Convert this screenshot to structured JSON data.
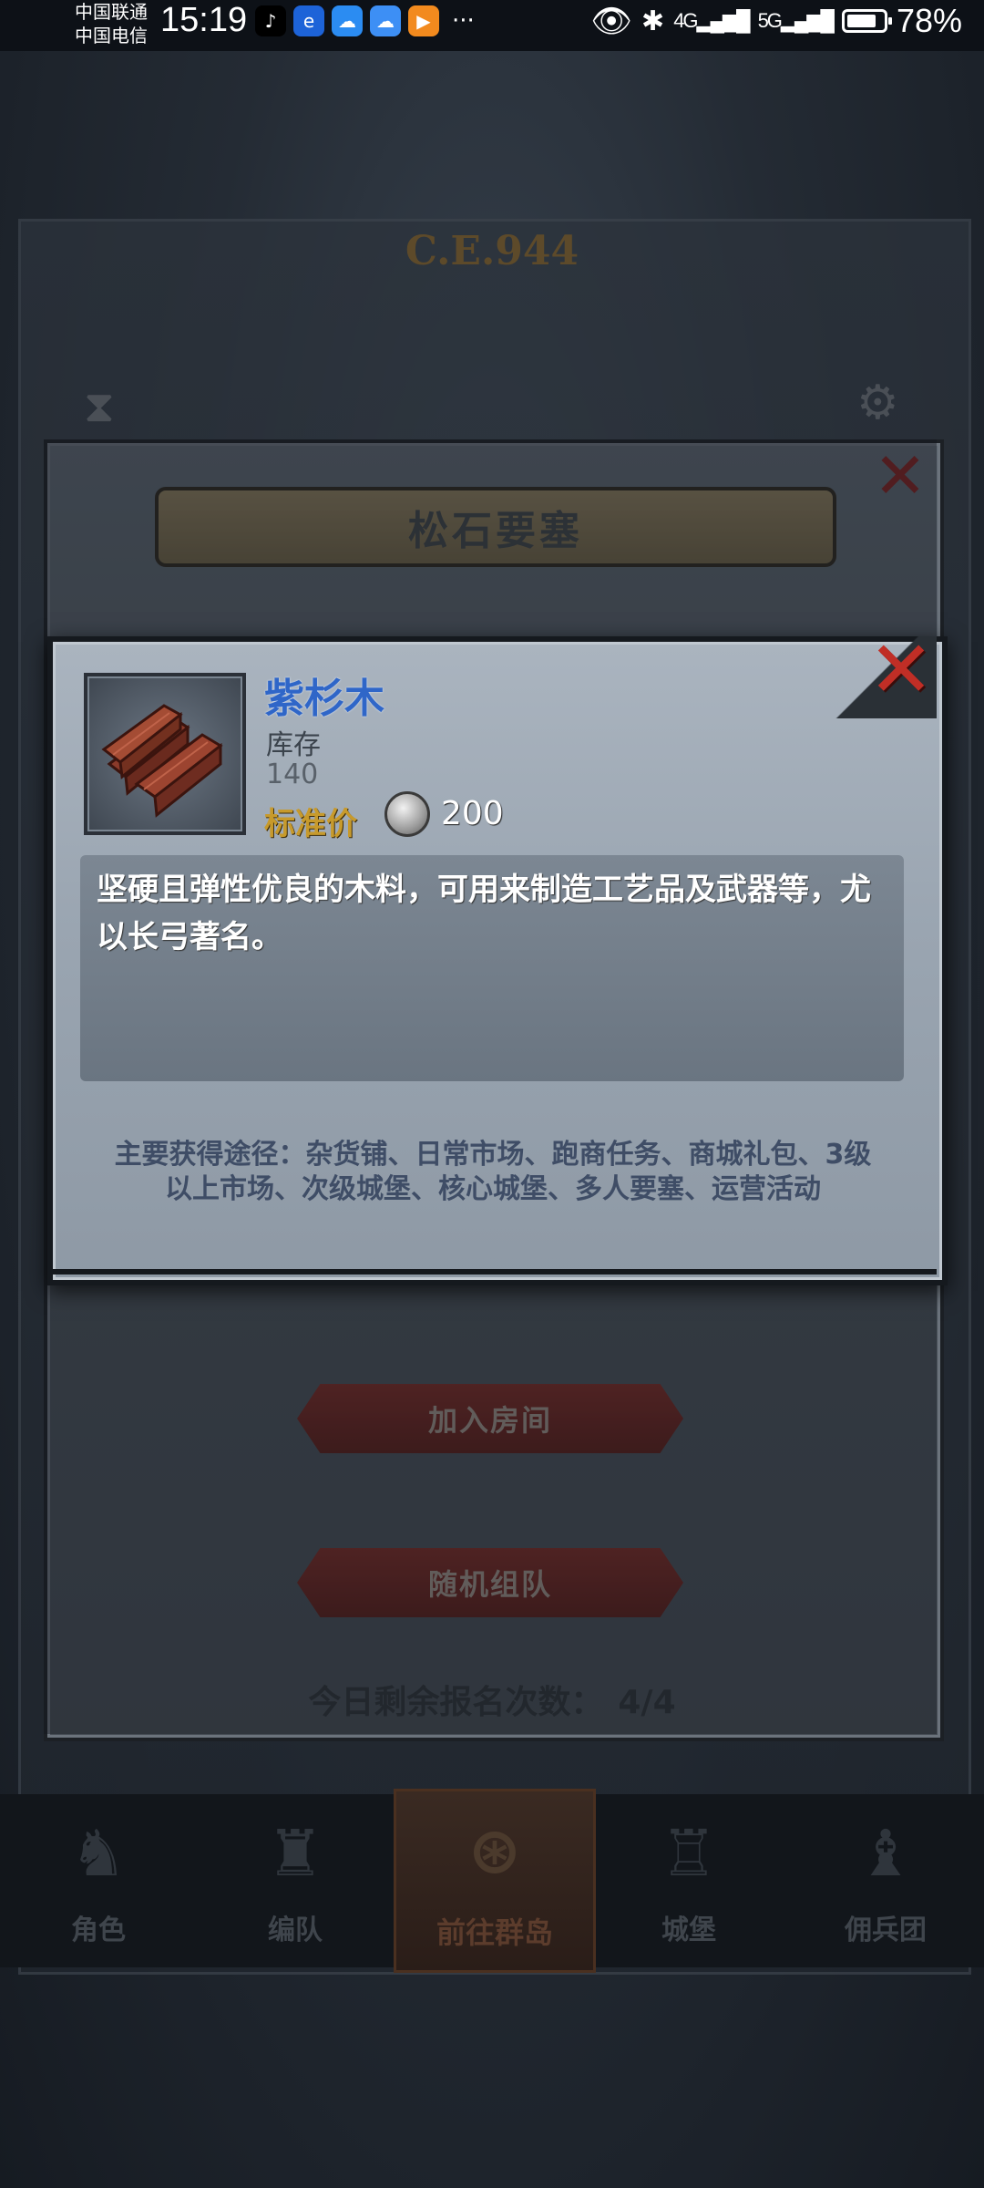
{
  "status_bar": {
    "carrier_1": "中国联通",
    "carrier_2": "中国电信",
    "time": "15:19",
    "app_icons": [
      "tiktok-icon",
      "browser-icon",
      "cloud-icon",
      "cloud-sync-icon",
      "video-icon"
    ],
    "more": "···",
    "network_1": "4G",
    "network_2": "5G",
    "battery": "78%"
  },
  "background": {
    "era_label": "C.E.944"
  },
  "panel": {
    "title": "松石要塞",
    "join_room_label": "加入房间",
    "random_team_label": "随机组队",
    "remaining_label": "今日剩余报名次数：",
    "remaining_count": "4/4"
  },
  "bottom_nav": {
    "items": [
      {
        "label": "角色",
        "icon": "character-icon"
      },
      {
        "label": "编队",
        "icon": "team-icon"
      },
      {
        "label": "前往群岛",
        "icon": "archipelago-icon"
      },
      {
        "label": "城堡",
        "icon": "castle-icon"
      },
      {
        "label": "佣兵团",
        "icon": "mercenary-icon"
      }
    ]
  },
  "item_popup": {
    "name": "紫杉木",
    "stock_label": "库存",
    "stock_value": "140",
    "price_label": "标准价",
    "price_value": "200",
    "description": "坚硬且弹性优良的木料，可用来制造工艺品及武器等，尤以长弓著名。",
    "sources": "主要获得途径：杂货铺、日常市场、跑商任务、商城礼包、3级以上市场、次级城堡、核心城堡、多人要塞、运营活动"
  },
  "colors": {
    "item_name": "#2f66c8",
    "price_label": "#c79a2c",
    "close_x": "#c02e26",
    "button": "#7a2b26"
  }
}
